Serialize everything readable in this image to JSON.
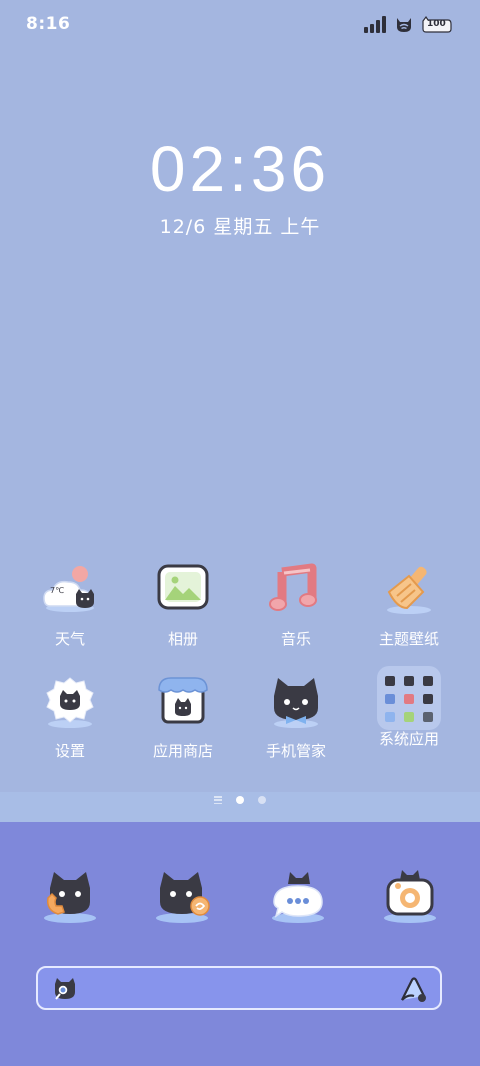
{
  "status": {
    "time": "8:16",
    "battery": "100"
  },
  "lockscreen": {
    "clock": "02:36",
    "date": "12/6 星期五 上午"
  },
  "apps": [
    {
      "label": "天气",
      "icon": "weather-icon"
    },
    {
      "label": "相册",
      "icon": "gallery-icon"
    },
    {
      "label": "音乐",
      "icon": "music-icon"
    },
    {
      "label": "主题壁纸",
      "icon": "theme-brush-icon"
    },
    {
      "label": "设置",
      "icon": "settings-icon"
    },
    {
      "label": "应用商店",
      "icon": "app-store-icon"
    },
    {
      "label": "手机管家",
      "icon": "phone-manager-icon"
    },
    {
      "label": "系统应用",
      "icon": "system-apps-folder-icon"
    }
  ],
  "weather_temp": "7℃",
  "dock": [
    {
      "icon": "phone-icon"
    },
    {
      "icon": "browser-icon"
    },
    {
      "icon": "messages-icon"
    },
    {
      "icon": "camera-icon"
    }
  ],
  "pages": {
    "count": 2,
    "active": 0
  },
  "colors": {
    "background": "#a4b6e0",
    "dock": "#7f88da",
    "search": "#8794ec",
    "cat": "#3a3a44"
  }
}
